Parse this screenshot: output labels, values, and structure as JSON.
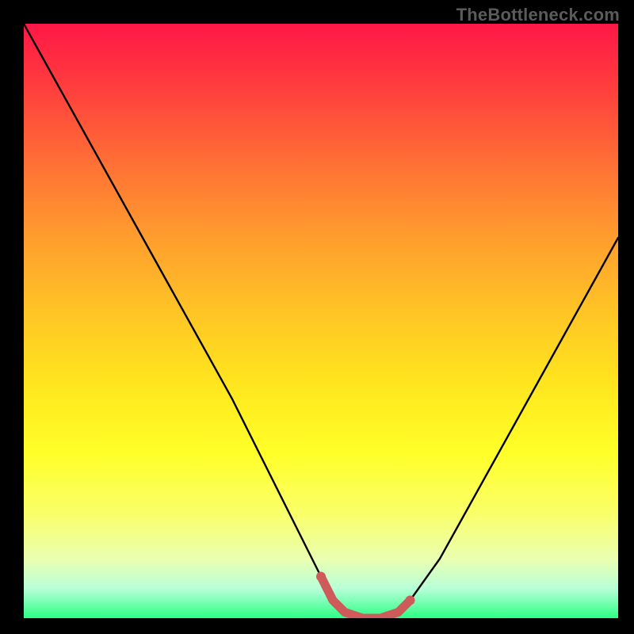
{
  "watermark": "TheBottleneck.com",
  "chart_data": {
    "type": "line",
    "title": "",
    "xlabel": "",
    "ylabel": "",
    "xlim": [
      0,
      100
    ],
    "ylim": [
      0,
      100
    ],
    "grid": false,
    "legend": false,
    "x": [
      0,
      5,
      10,
      15,
      20,
      25,
      30,
      35,
      40,
      45,
      50,
      52,
      54,
      57,
      60,
      63,
      65,
      70,
      75,
      80,
      85,
      90,
      95,
      100
    ],
    "series": [
      {
        "name": "curve",
        "values": [
          100,
          91,
          82,
          73,
          64,
          55,
          46,
          37,
          27,
          17,
          7,
          3,
          1,
          0,
          0,
          1,
          3,
          10,
          19,
          28,
          37,
          46,
          55,
          64
        ]
      }
    ],
    "highlight": {
      "color": "#cf5a5a",
      "x_range": [
        50,
        65
      ]
    },
    "background_gradient": {
      "top": "#ff1746",
      "bottom": "#2cff85"
    }
  }
}
